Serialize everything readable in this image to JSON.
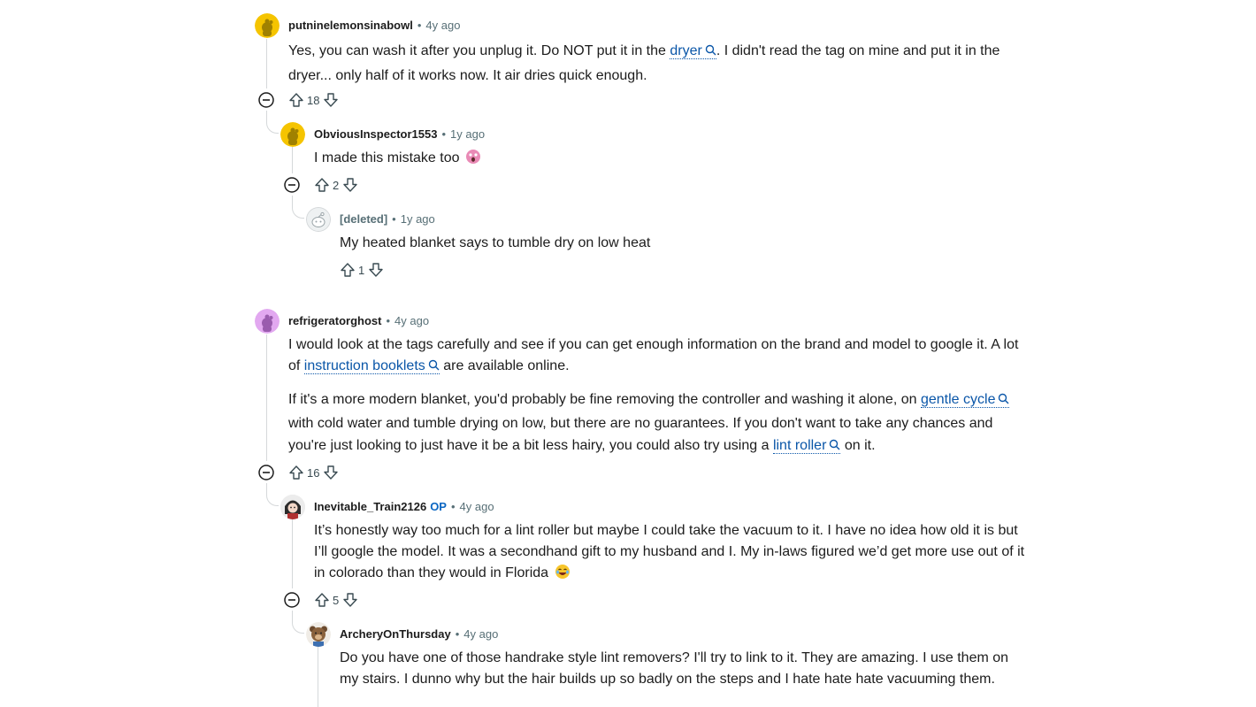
{
  "comments": [
    {
      "username": "putninelemonsinabowl",
      "time": "4y ago",
      "text_pre": "Yes, you can wash it after you unplug it. Do NOT put it in the ",
      "link": "dryer",
      "text_post": ". I didn't read the tag on mine and put it in the dryer... only half of it works now. It air dries quick enough.",
      "votes": "18"
    },
    {
      "username": "ObviousInspector1553",
      "time": "1y ago",
      "text": "I made this mistake too",
      "votes": "2"
    },
    {
      "username": "[deleted]",
      "time": "1y ago",
      "text": "My heated blanket says to tumble dry on low heat",
      "votes": "1"
    },
    {
      "username": "refrigeratorghost",
      "time": "4y ago",
      "p1_pre": "I would look at the tags carefully and see if you can get enough information on the brand and model to google it. A lot of ",
      "p1_link": "instruction booklets",
      "p1_post": " are available online.",
      "p2_pre": "If it's a more modern blanket, you'd probably be fine removing the controller and washing it alone, on ",
      "p2_link1": "gentle cycle",
      "p2_mid": " with cold water and tumble drying on low, but there are no guarantees. If you don't want to take any chances and you're just looking to just have it be a bit less hairy, you could also try using a ",
      "p2_link2": "lint roller",
      "p2_post": " on it.",
      "votes": "16"
    },
    {
      "username": "Inevitable_Train2126",
      "op": "OP",
      "time": "4y ago",
      "text": "It’s honestly way too much for a lint roller but maybe I could take the vacuum to it. I have no idea how old it is but I’ll google the model. It was a secondhand gift to my husband and I. My in-laws figured we’d get more use out of it in colorado than they would in Florida",
      "votes": "5"
    },
    {
      "username": "ArcheryOnThursday",
      "time": "4y ago",
      "text": "Do you have one of those handrake style lint removers? I'll try to link to it. They are amazing. I use them on my stairs. I dunno why but the hair builds up so badly on the steps and I hate hate hate vacuuming them."
    }
  ],
  "meta_separator": "•",
  "icons": {
    "upvote": "arrow-up-outline",
    "downvote": "arrow-down-outline",
    "collapse": "circle-minus",
    "search": "magnifier",
    "emoji_1": "scream-face",
    "emoji_2": "laughing-face"
  },
  "colors": {
    "link": "#0a56a8",
    "op_badge": "#0a66c2",
    "thread_line": "#d5d8da",
    "muted": "#576f76"
  }
}
